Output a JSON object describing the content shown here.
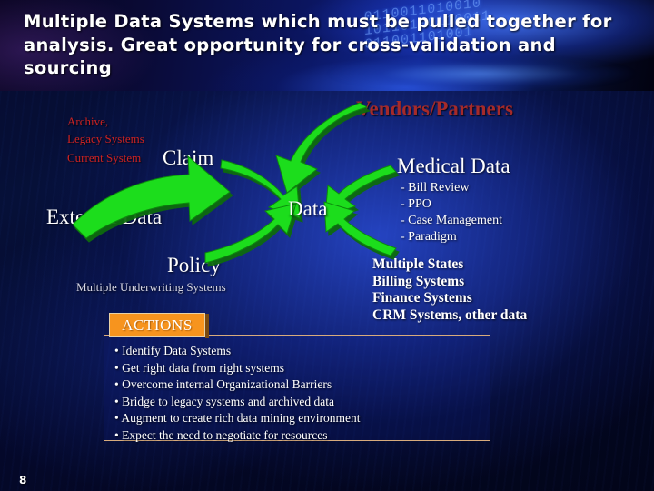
{
  "slide": {
    "page_number": "8",
    "title": "Multiple Data Systems which must be pulled together for analysis.  Great opportunity for cross-validation and sourcing",
    "background_texture": "binary-code-blue",
    "binary_text": "0110011010010\n10110100110011\n011001101001"
  },
  "colors": {
    "accent_orange": "#f7941e",
    "box_border": "#d8ab7c",
    "arrow_green": "#22dd22",
    "arrow_shadow": "#0a7a0a",
    "label_red": "#cc2222",
    "heading_red": "#a52a2a",
    "text_white": "#ffffff",
    "background_navy": "#061038"
  },
  "diagram": {
    "center_label": "Data",
    "left": {
      "archive_legacy": "Archive,\nLegacy Systems",
      "current_system": "Current System",
      "claim": "Claim",
      "external_data": "External Data",
      "policy": "Policy",
      "multiple_underwriting_systems": "Multiple Underwriting Systems"
    },
    "right": {
      "vendors_partners": "Vendors/Partners",
      "medical_data": "Medical Data",
      "medical_data_items": [
        "- Bill Review",
        "- PPO",
        "- Case Management",
        "- Paradigm"
      ],
      "systems_items": [
        "Multiple States",
        "Billing Systems",
        "Finance Systems",
        "CRM Systems, other data"
      ]
    }
  },
  "actions": {
    "tab_label": "ACTIONS",
    "items": [
      "• Identify Data Systems",
      "• Get right data from right systems",
      "• Overcome internal Organizational Barriers",
      "• Bridge to legacy systems and archived data",
      "• Augment to create rich data mining environment",
      "• Expect the need to negotiate for resources"
    ]
  }
}
